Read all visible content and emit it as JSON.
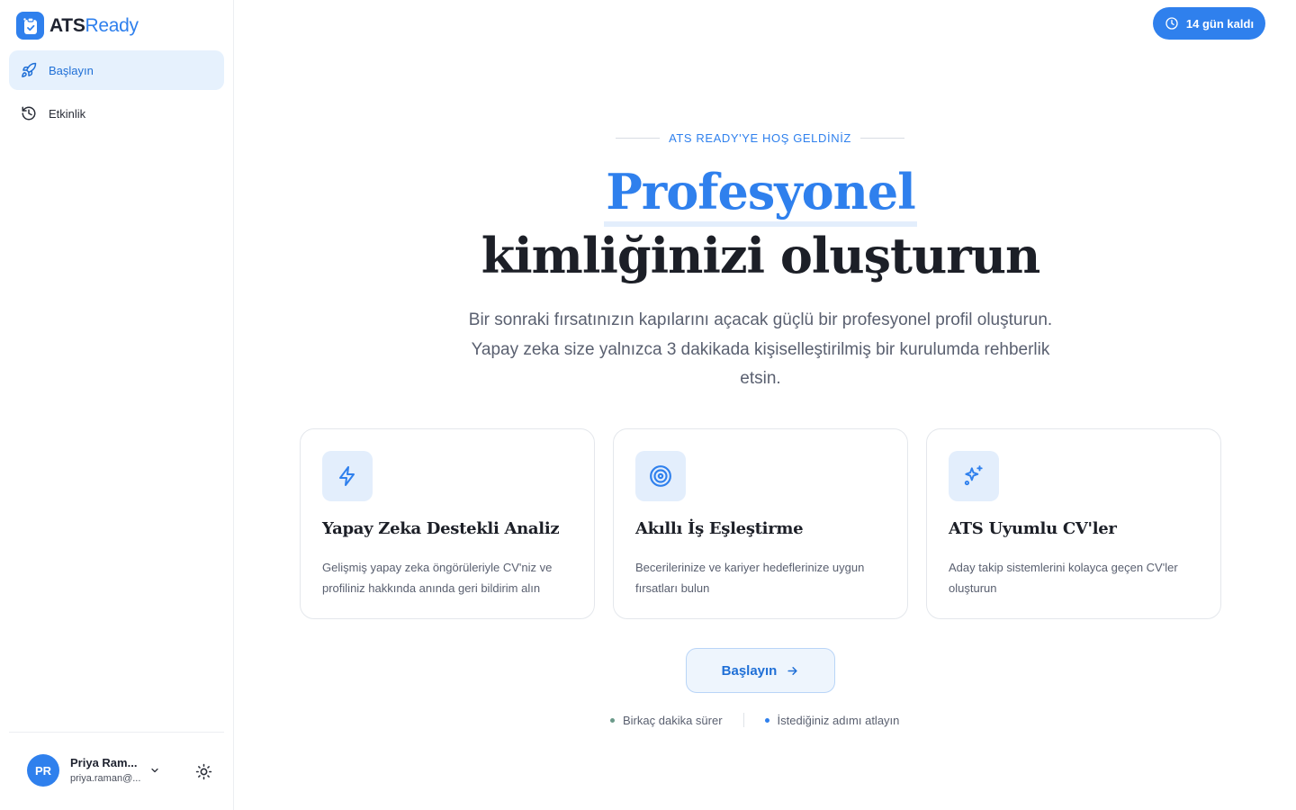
{
  "brand": {
    "name_part1": "ATS",
    "name_part2": "Ready"
  },
  "sidebar": {
    "items": [
      {
        "label": "Başlayın",
        "icon": "rocket-icon",
        "active": true
      },
      {
        "label": "Etkinlik",
        "icon": "history-icon",
        "active": false
      }
    ]
  },
  "user": {
    "initials": "PR",
    "name": "Priya Ram...",
    "email": "priya.raman@..."
  },
  "trial": {
    "label": "14 gün kaldı"
  },
  "hero": {
    "eyebrow": "ATS READY'YE HOŞ GELDİNİZ",
    "title_line1": "Profesyonel",
    "title_line2": "kimliğinizi oluşturun",
    "subtitle": "Bir sonraki fırsatınızın kapılarını açacak güçlü bir profesyonel profil oluşturun. Yapay zeka size yalnızca 3 dakikada kişiselleştirilmiş bir kurulumda rehberlik etsin."
  },
  "features": [
    {
      "icon": "lightning-icon",
      "title": "Yapay Zeka Destekli Analiz",
      "desc": "Gelişmiş yapay zeka öngörüleriyle CV'niz ve profiliniz hakkında anında geri bildirim alın"
    },
    {
      "icon": "target-icon",
      "title": "Akıllı İş Eşleştirme",
      "desc": "Becerilerinize ve kariyer hedeflerinize uygun fırsatları bulun"
    },
    {
      "icon": "sparkles-icon",
      "title": "ATS Uyumlu CV'ler",
      "desc": "Aday takip sistemlerini kolayca geçen CV'ler oluşturun"
    }
  ],
  "cta": {
    "label": "Başlayın"
  },
  "hints": [
    {
      "label": "Birkaç dakika sürer",
      "dot_color": "#6b9a8a"
    },
    {
      "label": "İstediğiniz adımı atlayın",
      "dot_color": "#2f80ed"
    }
  ],
  "colors": {
    "accent": "#2f80ed",
    "accent_soft": "#e3eefc",
    "text": "#1c1f27",
    "muted": "#5a6070"
  }
}
